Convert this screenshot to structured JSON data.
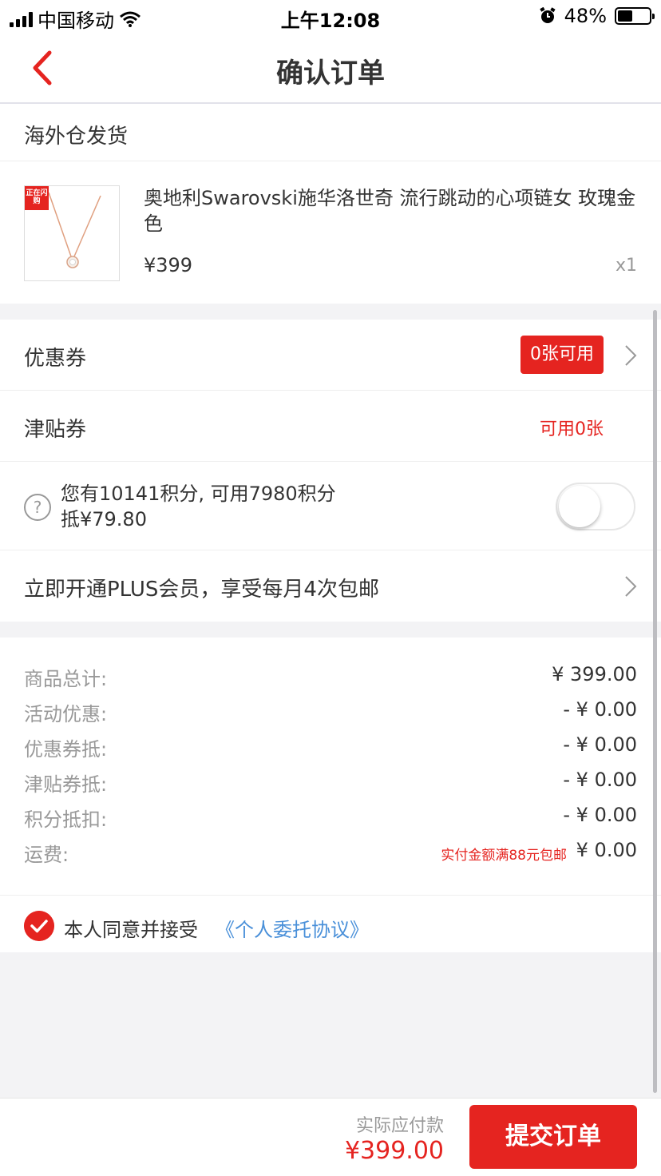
{
  "status_bar": {
    "carrier": "中国移动",
    "time": "上午12:08",
    "battery": "48%",
    "battery_level": 0.48
  },
  "nav": {
    "title": "确认订单"
  },
  "shipping": {
    "label": "海外仓发货"
  },
  "product": {
    "tag": "正在闪购",
    "title": "奥地利Swarovski施华洛世奇 流行跳动的心项链女 玫瑰金色",
    "price": "¥399",
    "quantity": "x1"
  },
  "discounts": {
    "coupon_label": "优惠券",
    "coupon_badge": "0张可用",
    "subsidy_label": "津贴券",
    "subsidy_value": "可用0张",
    "points_help_glyph": "?",
    "points_line1": "您有10141积分, 可用7980积分",
    "points_line2": "抵¥79.80",
    "points_toggle_on": false,
    "plus_label": "立即开通PLUS会员，享受每月4次包邮"
  },
  "summary": {
    "rows": [
      {
        "label": "商品总计:",
        "value": "¥ 399.00"
      },
      {
        "label": "活动优惠:",
        "value": "- ¥ 0.00"
      },
      {
        "label": "优惠券抵:",
        "value": "- ¥ 0.00"
      },
      {
        "label": "津贴券抵:",
        "value": "- ¥ 0.00"
      },
      {
        "label": "积分抵扣:",
        "value": "- ¥ 0.00"
      },
      {
        "label": "运费:",
        "value": "¥ 0.00"
      }
    ],
    "shipping_note": "实付金额满88元包邮"
  },
  "agreement": {
    "text": "本人同意并接受",
    "link": "《个人委托协议》",
    "checked": true
  },
  "footer": {
    "pay_label": "实际应付款",
    "pay_amount": "¥399.00",
    "submit_label": "提交订单"
  },
  "colors": {
    "accent": "#e52420",
    "link": "#4a90d9",
    "muted": "#999999"
  }
}
